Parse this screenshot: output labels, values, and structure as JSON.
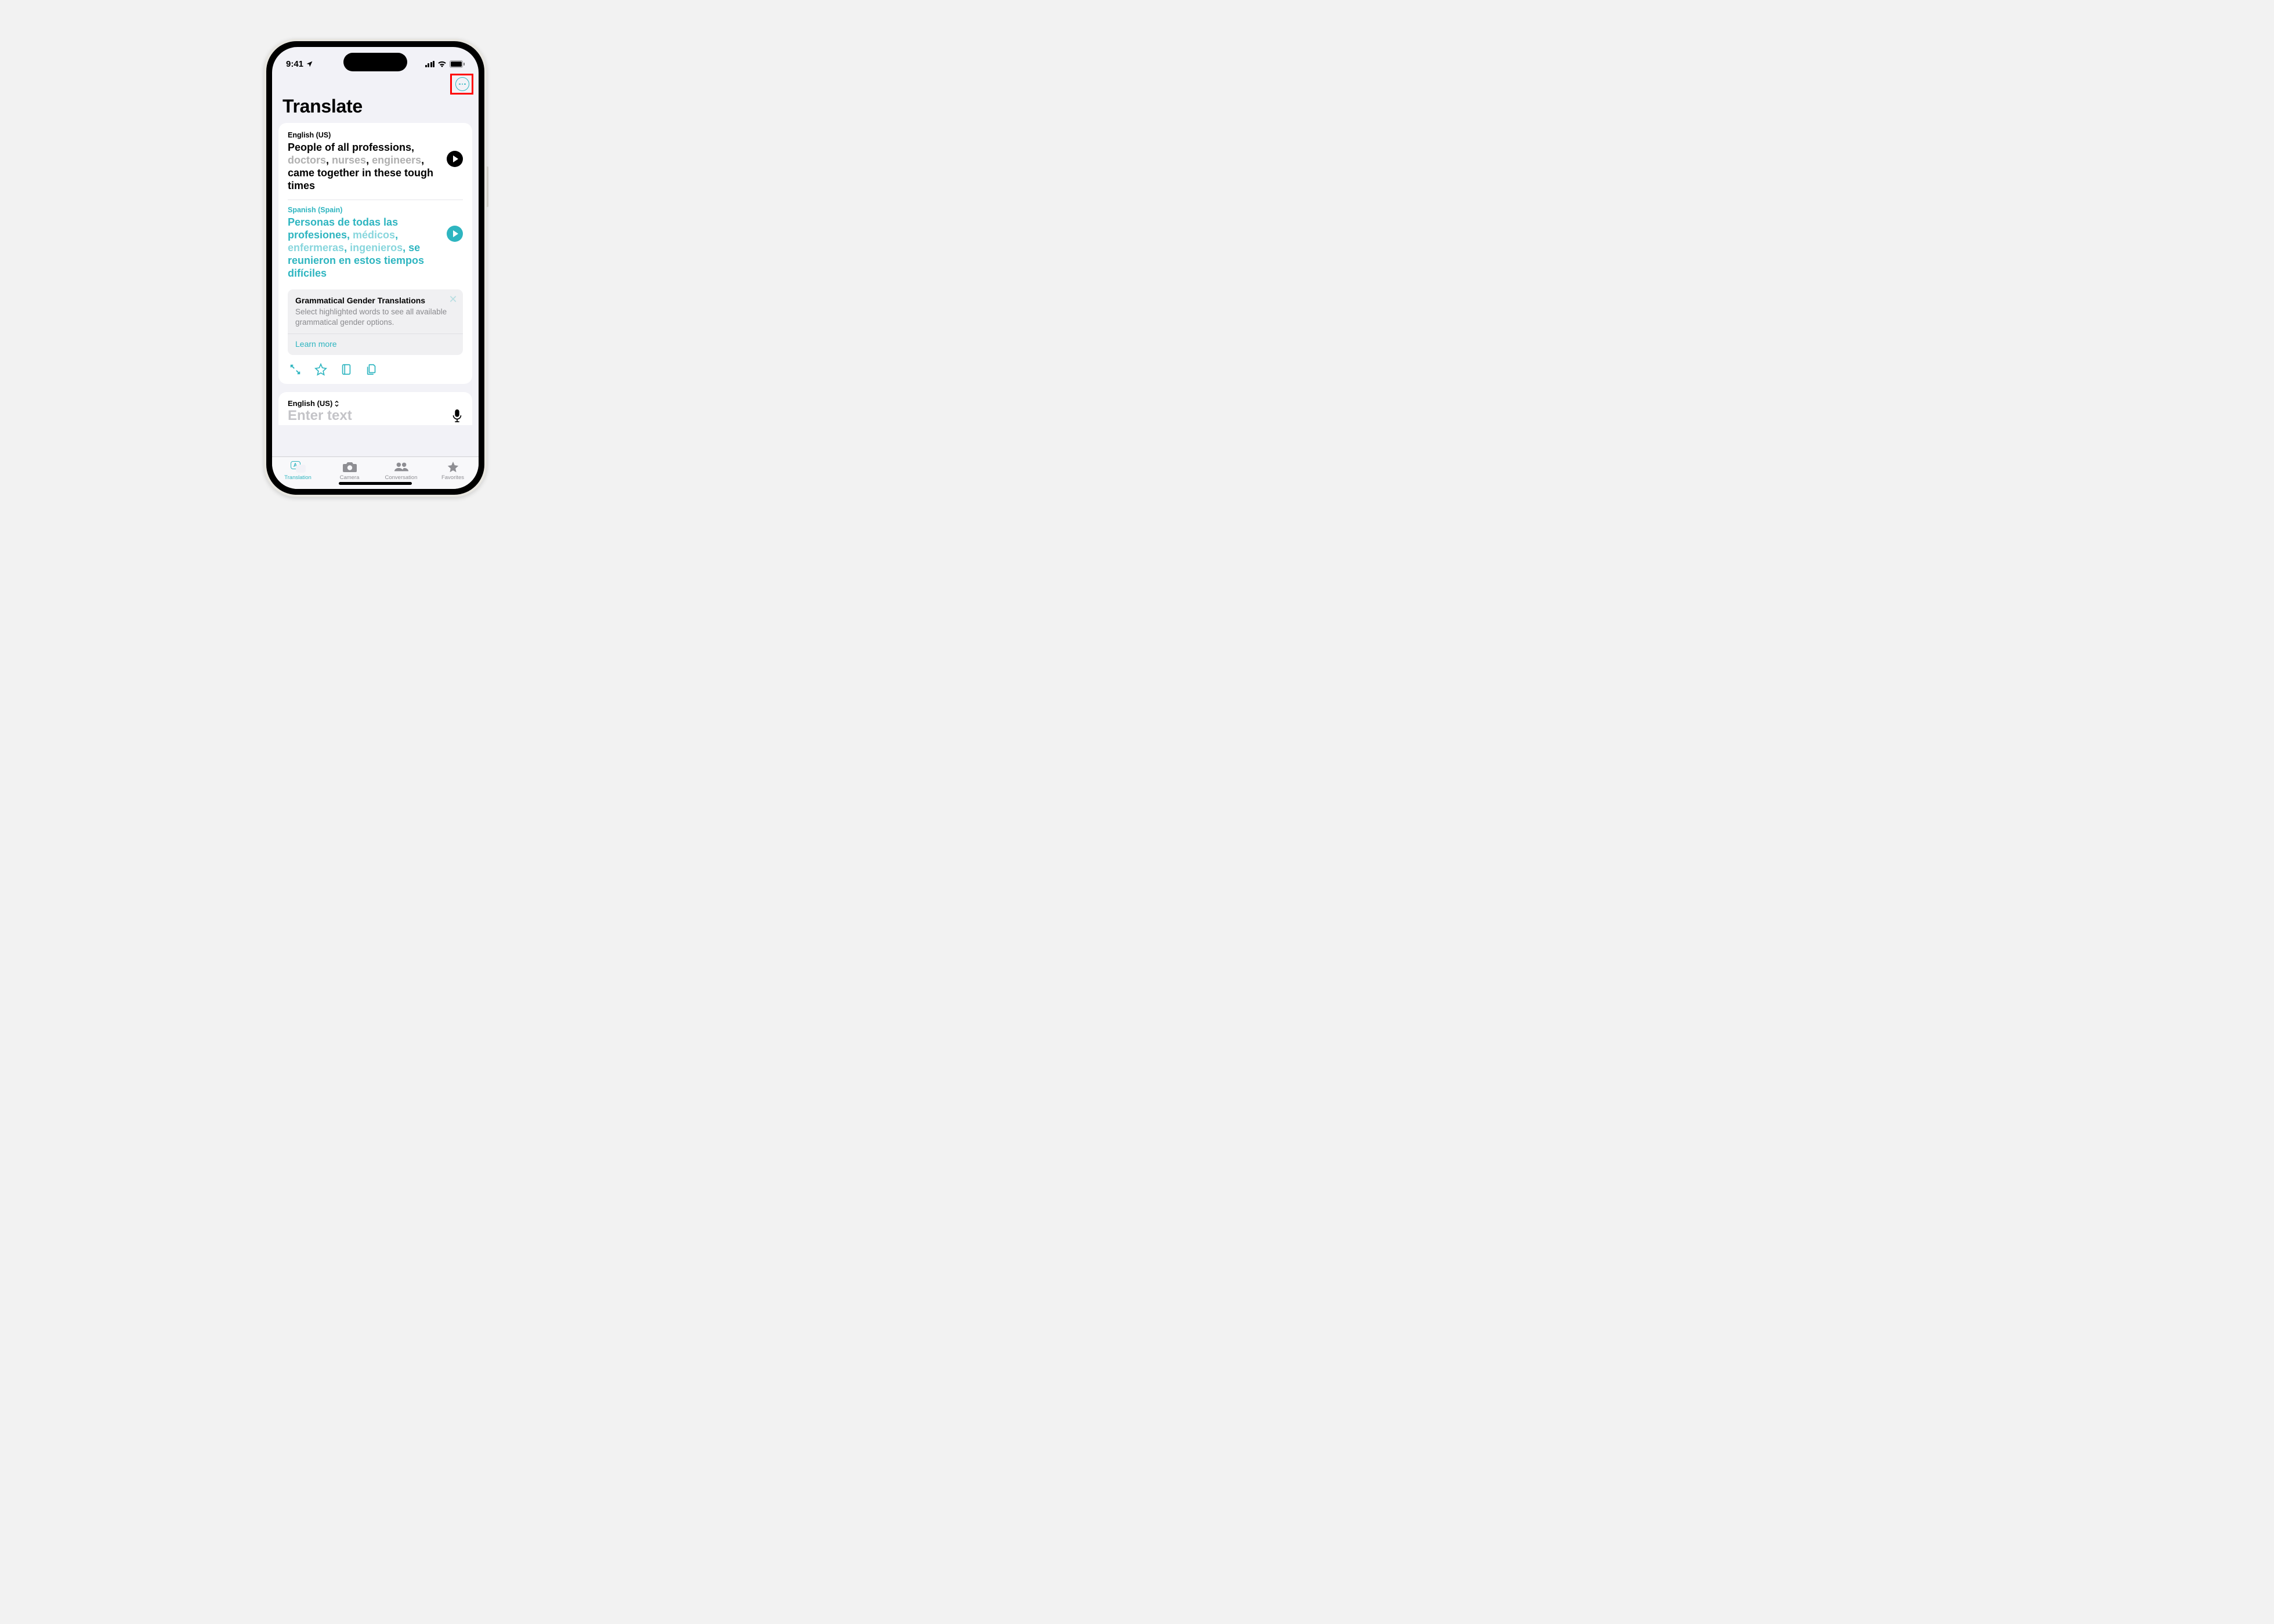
{
  "status": {
    "time": "9:41"
  },
  "header": {
    "title": "Translate"
  },
  "translation": {
    "source_lang": "English (US)",
    "source_parts": {
      "p1": "People of all professions, ",
      "h1": "doctors",
      "p2": ", ",
      "h2": "nurses",
      "p3": ", ",
      "h3": "engineers",
      "p4": ", came together in these tough times"
    },
    "target_lang": "Spanish (Spain)",
    "target_parts": {
      "p1": "Personas de todas las profesiones, ",
      "h1": "médicos",
      "p2": ", ",
      "h2": "enfermeras",
      "p3": ", ",
      "h3": "ingenieros",
      "p4": ", se reunieron en estos tiempos difíciles"
    }
  },
  "info": {
    "title": "Grammatical Gender Translations",
    "body": "Select highlighted words to see all available grammatical gender options.",
    "link": "Learn more"
  },
  "input": {
    "lang": "English (US)",
    "placeholder": "Enter text"
  },
  "tabs": {
    "translation": "Translation",
    "camera": "Camera",
    "conversation": "Conversation",
    "favorites": "Favorites"
  },
  "colors": {
    "accent": "#2eb5c0",
    "highlight_box": "#ff0000"
  }
}
